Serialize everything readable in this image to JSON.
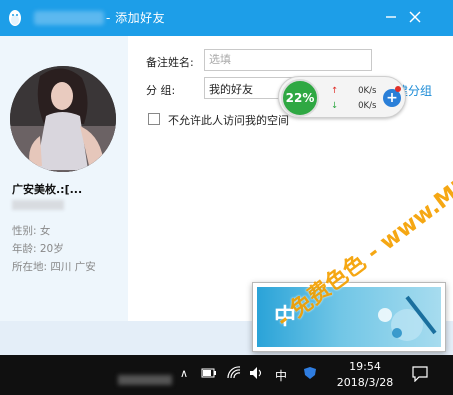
{
  "window": {
    "title": "- 添加好友"
  },
  "profile": {
    "nickname": "广安美枚.:[...",
    "gender": "性别: 女",
    "age": "年龄: 20岁",
    "location": "所在地: 四川  广安"
  },
  "form": {
    "remark_label": "备注姓名:",
    "remark_placeholder": "选填",
    "group_label": "分    组:",
    "group_value": "我的好友",
    "new_group_label": "建分组",
    "checkbox_label": "不允许此人访问我的空间"
  },
  "speed_widget": {
    "percent": "22%",
    "upload": "0K/s",
    "download": "0K/s"
  },
  "ime": {
    "char": "中"
  },
  "taskbar": {
    "ime_indicator": "中",
    "time": "19:54",
    "date": "2018/3/28"
  },
  "watermark": {
    "text": "- 免费色色 - www.MFsese.com"
  },
  "colors": {
    "titlebar": "#1d9ee8",
    "sidebar": "#eef6fc",
    "link": "#1b8bd6",
    "speed_green": "#2fa843",
    "watermark": "#f5a000"
  }
}
